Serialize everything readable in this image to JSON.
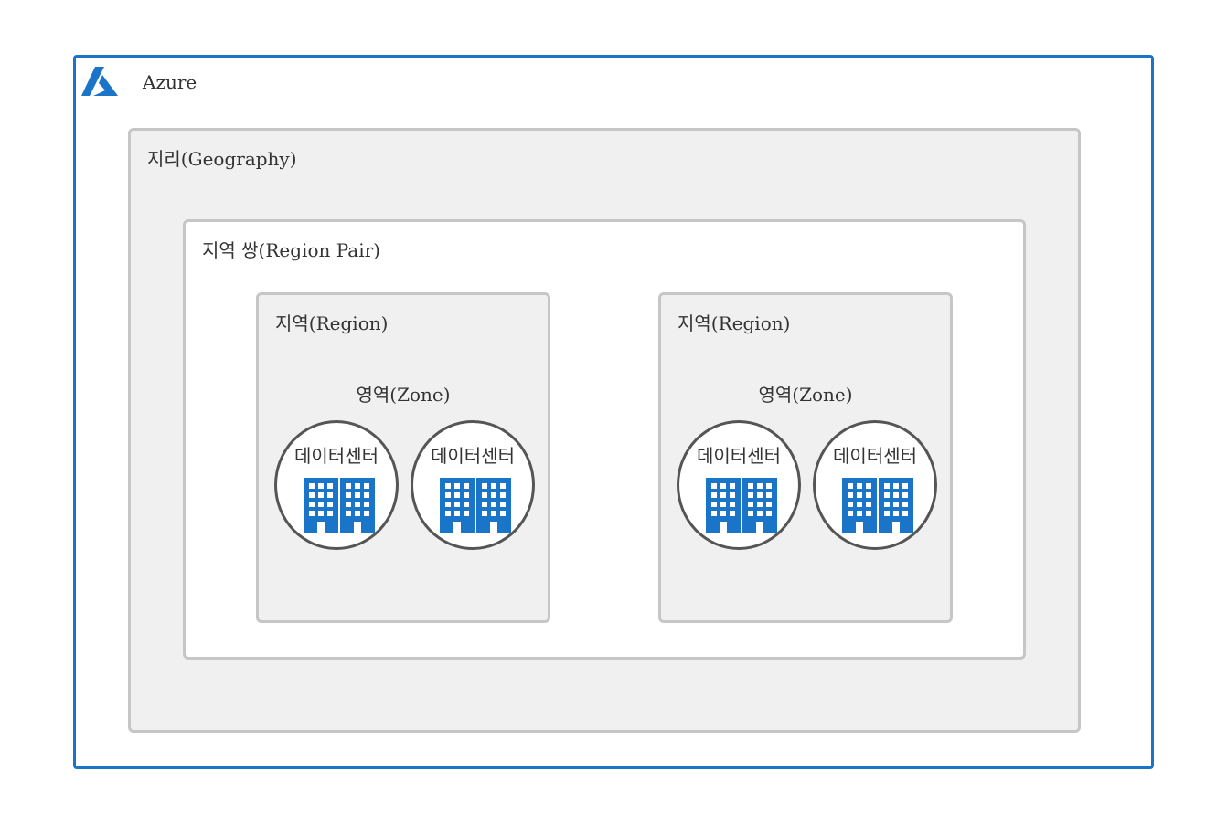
{
  "azure": {
    "title": "Azure",
    "logo_icon": "azure-logo-icon",
    "border_color": "#1a75c9"
  },
  "geography": {
    "title": "지리(Geography)"
  },
  "region_pair": {
    "title": "지역 쌍(Region Pair)"
  },
  "regions": [
    {
      "title": "지역(Region)",
      "zone": {
        "title": "영역(Zone)"
      },
      "datacenters": [
        {
          "label": "데이터센터",
          "icon": "building-icon"
        },
        {
          "label": "데이터센터",
          "icon": "building-icon"
        }
      ]
    },
    {
      "title": "지역(Region)",
      "zone": {
        "title": "영역(Zone)"
      },
      "datacenters": [
        {
          "label": "데이터센터",
          "icon": "building-icon"
        },
        {
          "label": "데이터센터",
          "icon": "building-icon"
        }
      ]
    }
  ],
  "colors": {
    "building": "#1a75c9",
    "box_fill": "#f0f0f0",
    "box_border": "#c6c6c6"
  }
}
